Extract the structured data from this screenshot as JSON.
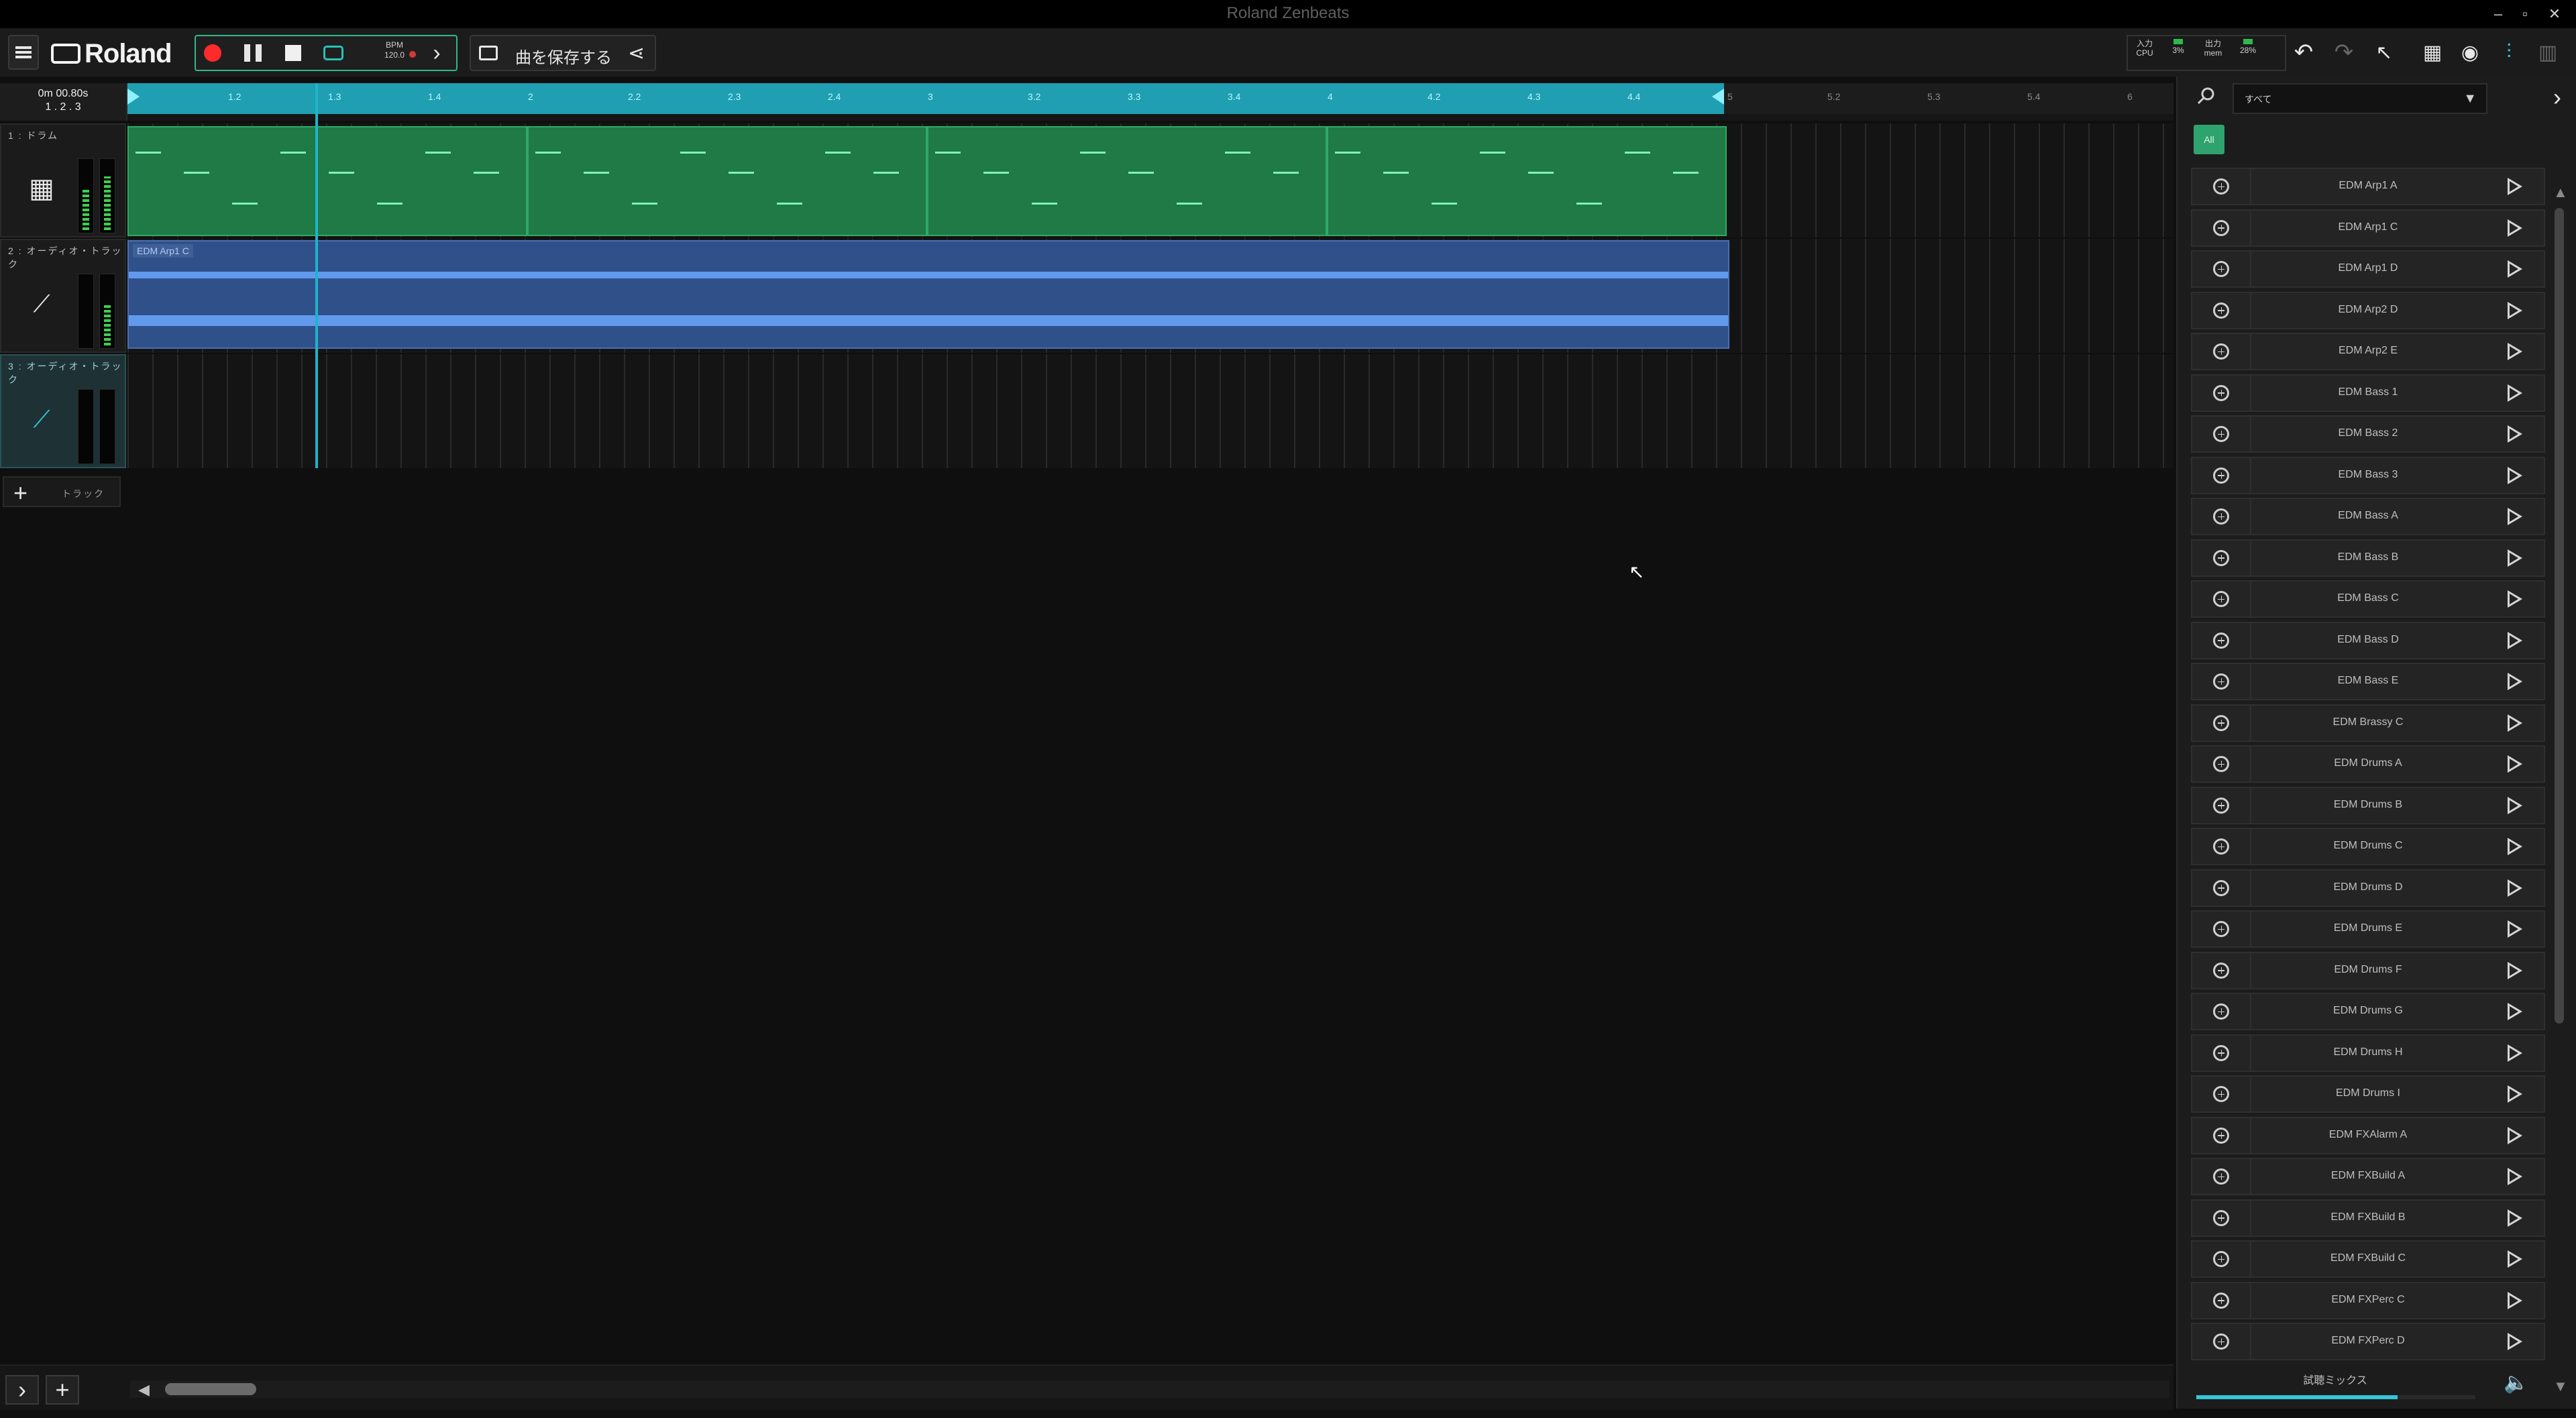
{
  "window": {
    "title": "Roland Zenbeats",
    "minimize": "–",
    "restore": "▫",
    "close": "✕"
  },
  "toolbar": {
    "brand": "Roland",
    "bpm_label": "BPM",
    "bpm_value": "120.0",
    "save_label": "曲を保存する",
    "monitor": [
      {
        "top": "入力",
        "label": "CPU",
        "value": ""
      },
      {
        "top": "",
        "label": "3%",
        "value": ""
      },
      {
        "top": "出力",
        "label": "mem",
        "value": ""
      },
      {
        "top": "",
        "label": "28%",
        "value": ""
      }
    ],
    "colors": {
      "accent": "#2fb88a",
      "record": "#ff2b2b",
      "loop": "#27c2b8"
    }
  },
  "timeline": {
    "timecode_time": "0m 00.80s",
    "timecode_pos": "1 . 2 . 3",
    "ticks": [
      "1.2",
      "1.3",
      "1.4",
      "2",
      "2.2",
      "2.3",
      "2.4",
      "3",
      "3.2",
      "3.3",
      "3.4",
      "4",
      "4.2",
      "4.3",
      "4.4",
      "5",
      "5.2",
      "5.3",
      "5.4",
      "6"
    ],
    "loop_end_index": 15,
    "colors": {
      "loop": "#1f9fb1",
      "drum": "#1f7a45",
      "audio": "#30508a"
    }
  },
  "tracks": [
    {
      "name": "1 : ドラム",
      "icon": "grid-pad-icon",
      "type": "drum"
    },
    {
      "name": "2 : オーディオ・トラック",
      "icon": "microphone-icon",
      "type": "audio",
      "clip": "EDM Arp1 C"
    },
    {
      "name": "3 : オーディオ・トラック",
      "icon": "microphone-icon",
      "type": "empty",
      "selected": true
    }
  ],
  "add_track_label": "トラック",
  "panel": {
    "category": "すべて",
    "all_label": "All",
    "loops": [
      "EDM Arp1 A",
      "EDM Arp1 C",
      "EDM Arp1 D",
      "EDM Arp2 D",
      "EDM Arp2 E",
      "EDM Bass 1",
      "EDM Bass 2",
      "EDM Bass 3",
      "EDM Bass A",
      "EDM Bass B",
      "EDM Bass C",
      "EDM Bass D",
      "EDM Bass E",
      "EDM Brassy C",
      "EDM Drums A",
      "EDM Drums B",
      "EDM Drums C",
      "EDM Drums D",
      "EDM Drums E",
      "EDM Drums F",
      "EDM Drums G",
      "EDM Drums H",
      "EDM Drums I",
      "EDM FXAlarm A",
      "EDM FXBuild A",
      "EDM FXBuild B",
      "EDM FXBuild C",
      "EDM FXPerc C",
      "EDM FXPerc D"
    ],
    "mix_label": "試聴ミックス",
    "mix_level": 0.72
  }
}
